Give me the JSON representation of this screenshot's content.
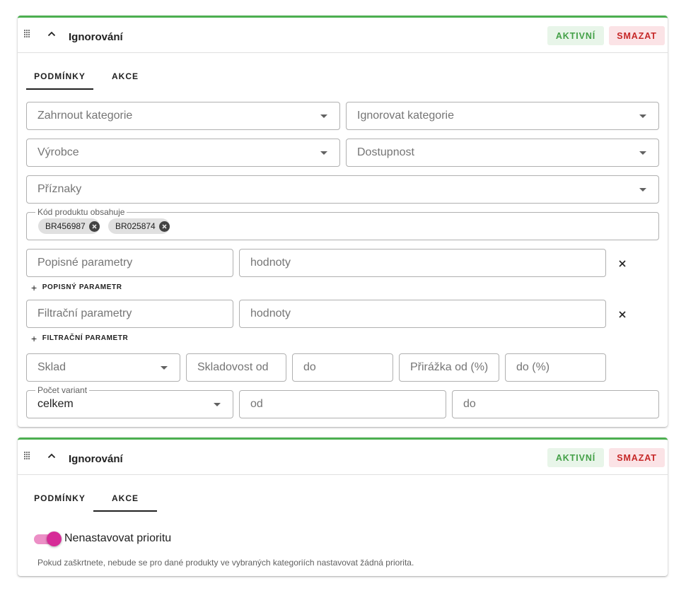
{
  "rules": [
    {
      "title": "Ignorování",
      "active_label": "AKTIVNÍ",
      "delete_label": "SMAZAT",
      "tabs": [
        "PODMÍNKY",
        "AKCE"
      ],
      "active_tab": "PODMÍNKY",
      "conditions": {
        "include_categories": {
          "placeholder": "Zahrnout kategorie"
        },
        "ignore_categories": {
          "placeholder": "Ignorovat kategorie"
        },
        "manufacturer": {
          "placeholder": "Výrobce"
        },
        "availability": {
          "placeholder": "Dostupnost"
        },
        "flags": {
          "placeholder": "Příznaky"
        },
        "product_code": {
          "label": "Kód produktu obsahuje",
          "chips": [
            "BR456987",
            "BR025874"
          ]
        },
        "descriptive_params": {
          "placeholder": "Popisné parametry",
          "values_placeholder": "hodnoty"
        },
        "add_descriptive_param": "POPISNÝ PARAMETR",
        "filter_params": {
          "placeholder": "Filtrační parametry",
          "values_placeholder": "hodnoty"
        },
        "add_filter_param": "FILTRAČNÍ PARAMETR",
        "warehouse": {
          "placeholder": "Sklad"
        },
        "stock_from": {
          "placeholder": "Skladovost od"
        },
        "stock_to": {
          "placeholder": "do"
        },
        "markup_from": {
          "placeholder": "Přirážka od (%)"
        },
        "markup_to": {
          "placeholder": "do (%)"
        },
        "variant_count": {
          "label": "Počet variant",
          "value": "celkem"
        },
        "variants_from": {
          "placeholder": "od"
        },
        "variants_to": {
          "placeholder": "do"
        }
      }
    },
    {
      "title": "Ignorování",
      "active_label": "AKTIVNÍ",
      "delete_label": "SMAZAT",
      "tabs": [
        "PODMÍNKY",
        "AKCE"
      ],
      "active_tab": "AKCE",
      "actions": {
        "no_priority_label": "Nenastavovat prioritu",
        "no_priority_checked": true,
        "hint": "Pokud zaškrtnete, nebude se pro dané produkty ve vybraných kategoriích nastavovat žádná priorita."
      }
    }
  ],
  "colors": {
    "card_accent": "#4caf50",
    "active_bg": "#e8f5e9",
    "active_text": "#43a047",
    "delete_bg": "#fbe3e6",
    "delete_text": "#c62828",
    "switch_thumb": "#d62b97",
    "switch_track": "#ec8fc6"
  }
}
